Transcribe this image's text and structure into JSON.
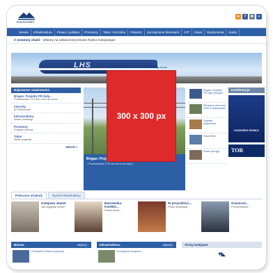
{
  "header": {
    "logo_text": "TREK\nKOLEJOWY",
    "logo_line1": "T R E K",
    "logo_line2": "KOLEJOWY",
    "icons": [
      {
        "name": "rss-icon",
        "color": "#f08a1c",
        "glyph": "≋"
      },
      {
        "name": "facebook-icon",
        "color": "#3b5998",
        "glyph": "f"
      },
      {
        "name": "mail-icon",
        "color": "#6c7f99",
        "glyph": "✉"
      },
      {
        "name": "other-icon",
        "color": "#2d5fa6",
        "glyph": "+"
      }
    ]
  },
  "nav": {
    "items": [
      "Serwis",
      "Infrastruktura",
      "Prawo i polityka",
      "Przewozy",
      "Tabor i technika",
      "Pasażer",
      "Zarządzanie finansami",
      "ICP",
      "Świat",
      "Wydarzenia",
      "Kadry"
    ]
  },
  "ticker": {
    "label": "Z ostatniej chwili:",
    "text": "Witamy na odświeżonej stronie Rynku Kolejowego!"
  },
  "banner": {
    "brand": "LHS",
    "caption": "PKP Linia Hutnicza Szerokotorowa sp. z o.o."
  },
  "left_column": {
    "header": "Najnowsze wiadomości",
    "items": [
      {
        "title": "Brigan: Projekty PR były...",
        "desc": "Przekazanie 175 mln euro na rzecz"
      },
      {
        "title": "Intercity",
        "desc": "W Polsce jest"
      },
      {
        "title": "Infrastruktura",
        "desc": "Nowe przetargi"
      },
      {
        "title": "Przewozy",
        "desc": "Kolejna umowa"
      },
      {
        "title": "Tabor",
        "desc": "Nowe pojazdy"
      }
    ],
    "more": "WIĘCEJ ›"
  },
  "center": {
    "headline": "Brigan: Projekty PR były wiodące",
    "body": "– Przekazanie 175 mln euro na rzecz..."
  },
  "ad": {
    "label": "300 x 300 px"
  },
  "right_list": {
    "items": [
      "Brigan: Projekty PR były wiodące",
      "Pierwsze elementy TMH w Warszawie",
      "Szybkie połączenia",
      "Nowa linia",
      "Nowe pociągi"
    ]
  },
  "far_right": {
    "header": "Konferencje",
    "kongres": "KONGRES RYNKU",
    "tor": "TOR"
  },
  "tabs": [
    "Polecane artykuły",
    "Rynek infrastruktury"
  ],
  "articles": [
    {
      "title": "Kolejowa Jesień",
      "desc": "Jak wygląda rynek?"
    },
    {
      "title": "Barcewska-Kontkie...",
      "desc": "Polski rynek..."
    },
    {
      "title": "W przyszłości...",
      "desc": "Plany inwestycji"
    },
    {
      "title": "Graniczni...",
      "desc": "Porozumienie..."
    }
  ],
  "bottom": {
    "sections": [
      {
        "title": "Biznes",
        "more": "więcej ›",
        "text": "Pewaknik Polski (nowości)"
      },
      {
        "title": "Infrastruktura",
        "more": "więcej ›",
        "text": "Kompania drogowa"
      },
      {
        "title": "Firmy kolejowe",
        "more": "",
        "text": ""
      }
    ]
  },
  "colors": {
    "nav_blue": "#2d5fa6",
    "ad_red": "#de2a2a",
    "dark_blue": "#1b3f7a"
  }
}
